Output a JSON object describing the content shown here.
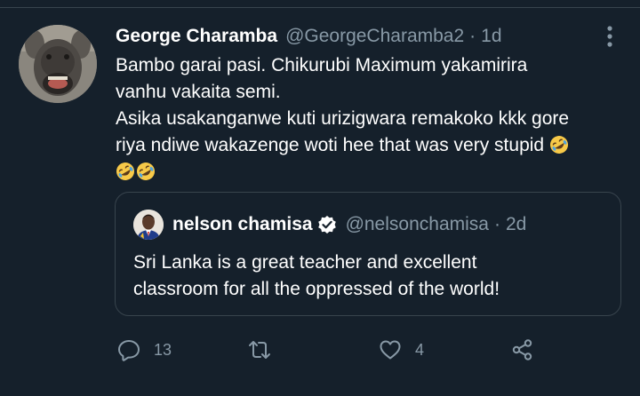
{
  "tweet": {
    "display_name": "George Charamba",
    "handle": "@GeorgeCharamba2",
    "separator": "·",
    "time": "1d",
    "text_lines": [
      "Bambo garai pasi. Chikurubi Maximum yakamirira",
      "vanhu vakaita semi.",
      "Asika usakanganwe kuti urizigwara remakoko kkk gore",
      "riya ndiwe wakazenge woti hee that was very stupid"
    ],
    "emoji_name": "rolling-on-floor-laughing"
  },
  "quoted_tweet": {
    "display_name": "nelson chamisa",
    "handle": "@nelsonchamisa",
    "separator": "·",
    "time": "2d",
    "text_lines": [
      "Sri Lanka is a great teacher and excellent",
      "classroom for all the oppressed of the world!"
    ]
  },
  "actions": {
    "reply_count": "13",
    "retweet_count": "",
    "like_count": "4"
  },
  "colors": {
    "background": "#15202b",
    "text_primary": "#ffffff",
    "text_secondary": "#8899a6",
    "border": "#38444d",
    "verified": "#ffffff"
  },
  "icons": [
    "more-vertical-icon",
    "verified-badge-icon",
    "reply-icon",
    "retweet-icon",
    "like-icon",
    "share-icon"
  ]
}
